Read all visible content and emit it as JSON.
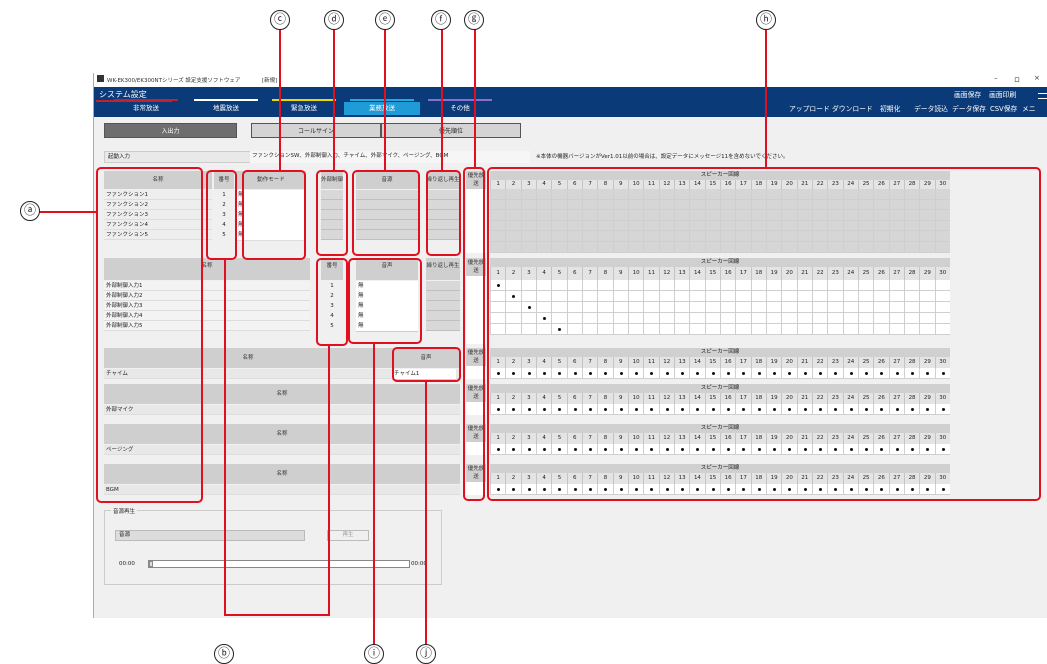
{
  "window": {
    "title": "WK-EK300/EK300NTシリーズ 設定支援ソフトウェア",
    "doc_state": "[新規]",
    "minimize": "–",
    "maximize": "ロ",
    "close": "×"
  },
  "header": {
    "title": "システム設定",
    "menu_icon": "menu-icon"
  },
  "tabs": [
    {
      "label": "非常放送",
      "color": "#c8202a"
    },
    {
      "label": "地震放送",
      "color": "#ffffff"
    },
    {
      "label": "緊急放送",
      "color": "#f0d800"
    },
    {
      "label": "業務放送",
      "color": "#22aadd",
      "active": true
    },
    {
      "label": "その他",
      "color": "#8b6fd0"
    }
  ],
  "right_buttons": {
    "screen_save": "画面保存",
    "screen_print": "画面印刷",
    "upload": "アップロード",
    "download": "ダウンロード",
    "initialize": "初期化",
    "data_load": "データ読込",
    "data_save": "データ保存",
    "csv_save": "CSV保存",
    "menu": "メニ"
  },
  "subtabs": [
    "入出力",
    "コールサイン",
    "優先順位"
  ],
  "start_input": {
    "label": "起動入力",
    "value": "ファンクションSW、外部制御入力、チャイム、外部マイク、ページング、BGM"
  },
  "note": "※本体の機器バージョンがVer1.01以前の場合は、設定データにメッセージ11を含めないでください。",
  "common": {
    "name": "名称",
    "number": "番号",
    "mode": "動作モード",
    "ext_ctrl": "外部制御",
    "source": "音源",
    "repeat": "繰り返し再生",
    "priority": "優先放送",
    "speaker_line": "スピーカー回線",
    "audio": "音声",
    "mu": "無"
  },
  "speaker_numbers": [
    "1",
    "2",
    "3",
    "4",
    "5",
    "6",
    "7",
    "8",
    "9",
    "10",
    "11",
    "12",
    "13",
    "14",
    "15",
    "16",
    "17",
    "18",
    "19",
    "20",
    "21",
    "22",
    "23",
    "24",
    "25",
    "26",
    "27",
    "28",
    "29",
    "30"
  ],
  "function_rows": [
    {
      "name": "ファンクション1",
      "no": "1",
      "mode": "無"
    },
    {
      "name": "ファンクション2",
      "no": "2",
      "mode": "無"
    },
    {
      "name": "ファンクション3",
      "no": "3",
      "mode": "無"
    },
    {
      "name": "ファンクション4",
      "no": "4",
      "mode": "無"
    },
    {
      "name": "ファンクション5",
      "no": "5",
      "mode": "無"
    }
  ],
  "ext_rows": [
    {
      "name": "外部制御入力1",
      "no": "1",
      "audio": "無"
    },
    {
      "name": "外部制御入力2",
      "no": "2",
      "audio": "無"
    },
    {
      "name": "外部制御入力3",
      "no": "3",
      "audio": "無"
    },
    {
      "name": "外部制御入力4",
      "no": "4",
      "audio": "無"
    },
    {
      "name": "外部制御入力5",
      "no": "5",
      "audio": "無"
    }
  ],
  "chime": {
    "name": "チャイム",
    "audio": "チャイム1"
  },
  "ext_mic": {
    "name": "外部マイク"
  },
  "paging": {
    "name": "ページング"
  },
  "bgm": {
    "name": "BGM"
  },
  "player": {
    "title": "音源再生",
    "source_label": "音源",
    "play": "再生",
    "time_start": "00:00",
    "time_end": "00:00"
  },
  "callouts": {
    "a": "ⓐ",
    "b": "ⓑ",
    "c": "ⓒ",
    "d": "ⓓ",
    "e": "ⓔ",
    "f": "ⓕ",
    "g": "ⓖ",
    "h": "ⓗ",
    "i": "ⓘ",
    "j": "ⓙ"
  }
}
